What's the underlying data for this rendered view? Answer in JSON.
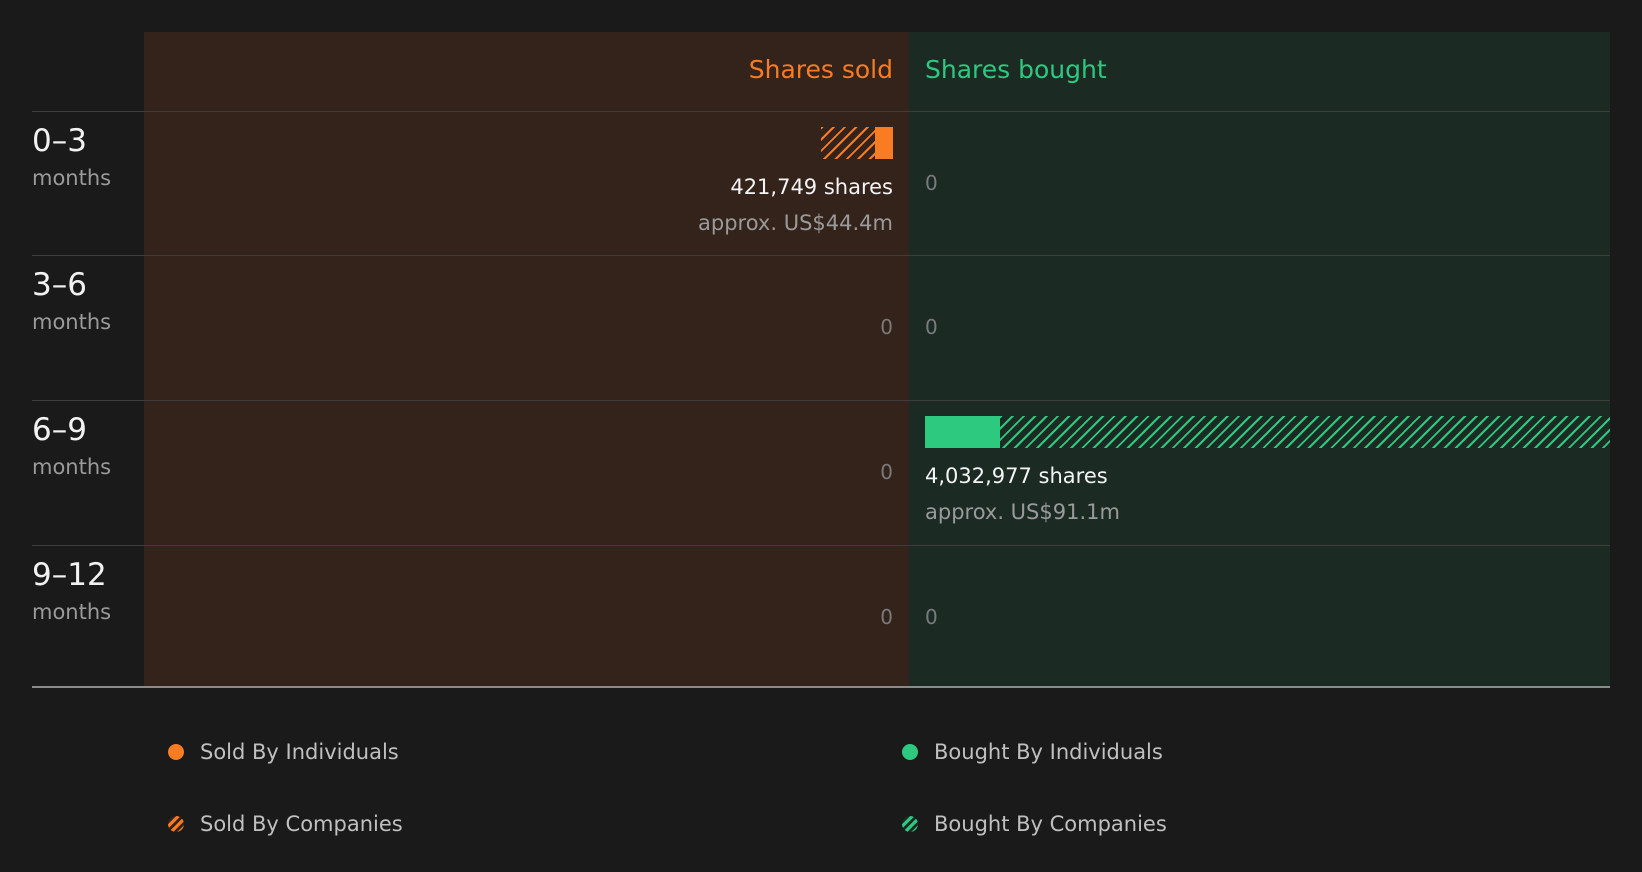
{
  "chart_data": {
    "type": "bar",
    "headers": {
      "sold": "Shares sold",
      "bought": "Shares bought"
    },
    "categories": [
      {
        "range": "0–3",
        "unit": "months"
      },
      {
        "range": "3–6",
        "unit": "months"
      },
      {
        "range": "6–9",
        "unit": "months"
      },
      {
        "range": "9–12",
        "unit": "months"
      }
    ],
    "sold": [
      {
        "shares": 421749,
        "shares_label": "421,749 shares",
        "value_label": "approx. US$44.4m",
        "individual_fraction": 0.25
      },
      {
        "shares": 0,
        "shares_label": "0"
      },
      {
        "shares": 0,
        "shares_label": "0"
      },
      {
        "shares": 0,
        "shares_label": "0"
      }
    ],
    "bought": [
      {
        "shares": 0,
        "shares_label": "0"
      },
      {
        "shares": 0,
        "shares_label": "0"
      },
      {
        "shares": 4032977,
        "shares_label": "4,032,977 shares",
        "value_label": "approx. US$91.1m",
        "individual_fraction": 0.11
      },
      {
        "shares": 0,
        "shares_label": "0"
      }
    ],
    "legend": [
      {
        "key": "sold-individuals",
        "label": "Sold By Individuals"
      },
      {
        "key": "bought-individuals",
        "label": "Bought By Individuals"
      },
      {
        "key": "sold-companies",
        "label": "Sold By Companies"
      },
      {
        "key": "bought-companies",
        "label": "Bought By Companies"
      }
    ],
    "colors": {
      "sold": "#f97b22",
      "bought": "#2dc97e"
    }
  }
}
